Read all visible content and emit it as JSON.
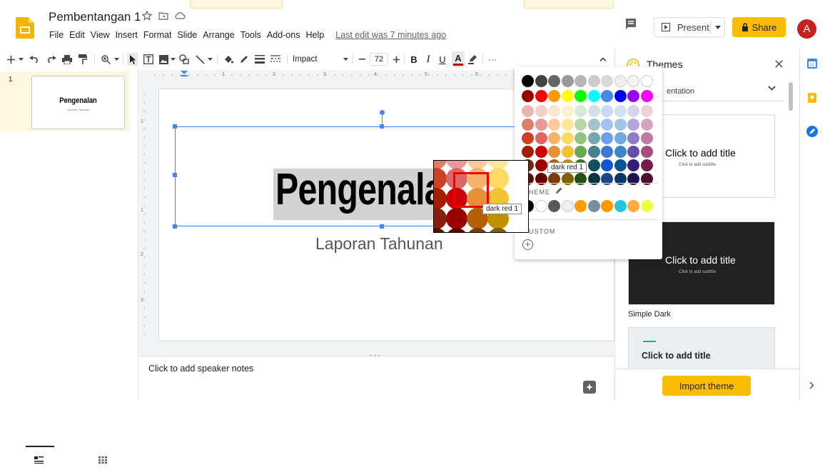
{
  "header": {
    "doc_title": "Pembentangan 1",
    "menu": [
      "File",
      "Edit",
      "View",
      "Insert",
      "Format",
      "Slide",
      "Arrange",
      "Tools",
      "Add-ons",
      "Help"
    ],
    "last_edit": "Last edit was 7 minutes ago",
    "present_label": "Present",
    "share_label": "Share",
    "avatar_letter": "A"
  },
  "toolbar": {
    "font_name": "Impact",
    "font_size": "72",
    "zoom_icon": "zoom-icon",
    "text_color": "#c00000"
  },
  "filmstrip": {
    "slide_number": "1",
    "thumb_title": "Pengenalan",
    "thumb_subtitle": "Laporan Tahunan"
  },
  "slide": {
    "title": "Pengenalan",
    "subtitle": "Laporan Tahunan"
  },
  "notes": {
    "placeholder": "Click to add speaker notes"
  },
  "themes": {
    "title": "Themes",
    "dropdown_text": "entation",
    "cards": [
      {
        "main": "Click to add title",
        "sub": "Click to add subtitle",
        "name": "ght",
        "bg": "#ffffff",
        "fg": "#000000"
      },
      {
        "main": "Click to add title",
        "sub": "Click to add subtitle",
        "name": "Simple Dark",
        "bg": "#212121",
        "fg": "#ffffff"
      },
      {
        "main": "Click to add title",
        "sub": "",
        "name": "",
        "bg": "#eceff1",
        "fg": "#202124"
      }
    ],
    "import_label": "Import theme"
  },
  "color_picker": {
    "theme_label": "HEME",
    "custom_label": "USTOM",
    "tooltip": "dark red 1",
    "grid": [
      [
        "#000000",
        "#434343",
        "#666666",
        "#999999",
        "#b7b7b7",
        "#cccccc",
        "#d9d9d9",
        "#efefef",
        "#f3f3f3",
        "#ffffff"
      ],
      [
        "#980000",
        "#ff0000",
        "#ff9900",
        "#ffff00",
        "#00ff00",
        "#00ffff",
        "#4a86e8",
        "#0000ff",
        "#9900ff",
        "#ff00ff"
      ],
      [
        "#e6b8af",
        "#f4cccc",
        "#fce5cd",
        "#fff2cc",
        "#d9ead3",
        "#d0e0e3",
        "#c9daf8",
        "#cfe2f3",
        "#d9d2e9",
        "#ead1dc"
      ],
      [
        "#dd7e6b",
        "#ea9999",
        "#f9cb9c",
        "#ffe599",
        "#b6d7a8",
        "#a2c4c9",
        "#a4c2f4",
        "#9fc5e8",
        "#b4a7d6",
        "#d5a6bd"
      ],
      [
        "#cc4125",
        "#e06666",
        "#f6b26b",
        "#ffd966",
        "#93c47d",
        "#76a5af",
        "#6d9eeb",
        "#6fa8dc",
        "#8e7cc3",
        "#c27ba0"
      ],
      [
        "#a61c00",
        "#cc0000",
        "#e69138",
        "#f1c232",
        "#6aa84f",
        "#45818e",
        "#3c78d8",
        "#3d85c6",
        "#674ea7",
        "#a64d79"
      ],
      [
        "#85200c",
        "#990000",
        "#b45f06",
        "#bf9000",
        "#38761d",
        "#134f5c",
        "#1155cc",
        "#0b5394",
        "#351c75",
        "#741b47"
      ],
      [
        "#5b0f00",
        "#660000",
        "#783f04",
        "#7f6000",
        "#274e13",
        "#0c343d",
        "#1c4587",
        "#073763",
        "#20124d",
        "#4c1130"
      ]
    ],
    "theme_colors": [
      "#000000",
      "#ffffff",
      "#595959",
      "#eeeeee",
      "#ff9900",
      "#78909c",
      "#ff9900",
      "#26c6da",
      "#ffab40",
      "#eeff41"
    ],
    "magnifier_grid": [
      [
        "#dd7e6b",
        "#ea9999",
        "#f9cb9c",
        "#ffe599"
      ],
      [
        "#cc4125",
        "#e06666",
        "#f6b26b",
        "#ffd966"
      ],
      [
        "#a61c00",
        "#cc0000",
        "#e69138",
        "#f1c232"
      ],
      [
        "#85200c",
        "#990000",
        "#b45f06",
        "#bf9000"
      ],
      [
        "#5b0f00",
        "#660000",
        "#783f04",
        "#7f6000"
      ]
    ]
  }
}
